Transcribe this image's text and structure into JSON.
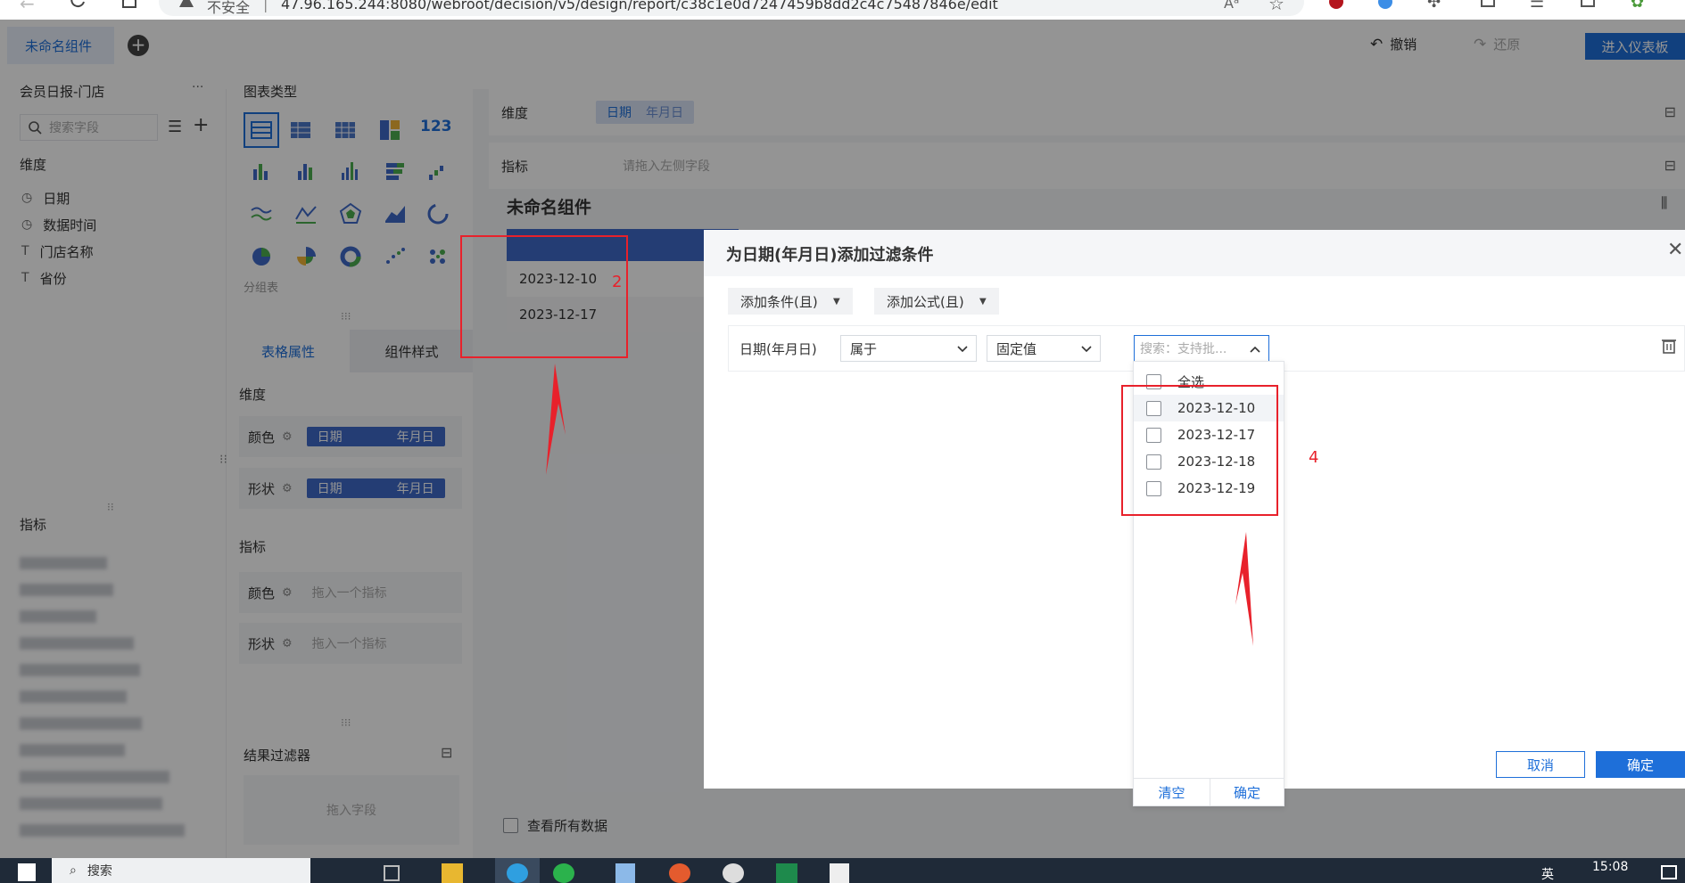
{
  "browser": {
    "security_label": "不安全",
    "url": "47.96.165.244:8080/webroot/decision/v5/design/report/c38c1e0d7247459b8dd2c4c75487846e/edit",
    "reader_label": "Aᵃ"
  },
  "app": {
    "component_name": "未命名组件",
    "undo_label": "撤销",
    "redo_label": "还原",
    "enter_dashboard_label": "进入仪表板"
  },
  "left": {
    "dataset_title": "会员日报-门店",
    "more_label": "···",
    "search_placeholder": "搜索字段",
    "dimension_header": "维度",
    "dimension_fields": [
      {
        "type_icon": "clock-icon",
        "label": "日期"
      },
      {
        "type_icon": "clock-icon",
        "label": "数据时间"
      },
      {
        "type_icon": "text-icon",
        "label": "门店名称"
      },
      {
        "type_icon": "text-icon",
        "label": "省份"
      }
    ],
    "measure_header": "指标"
  },
  "mid": {
    "chart_type_header": "图表类型",
    "chart_type_caption": "分组表",
    "tabs": [
      "表格属性",
      "组件样式"
    ],
    "dimension_header": "维度",
    "color_label": "颜色",
    "shape_label": "形状",
    "chip_field": "日期",
    "chip_sub": "年月日",
    "measure_header": "指标",
    "measure_placeholder": "拖入一个指标",
    "result_filter_label": "结果过滤器",
    "drag_field_placeholder": "拖入字段"
  },
  "work": {
    "dimension_label": "维度",
    "dimension_chip_field": "日期",
    "dimension_chip_sub": "年月日",
    "measure_label": "指标",
    "measure_placeholder": "请拖入左侧字段",
    "component_title": "未命名组件",
    "table_rows": [
      "2023-12-10",
      "2023-12-17"
    ],
    "view_all_label": "查看所有数据"
  },
  "dialog": {
    "title": "为日期(年月日)添加过滤条件",
    "add_condition_label": "添加条件(且)",
    "add_formula_label": "添加公式(且)",
    "condition_field": "日期(年月日)",
    "operator": "属于",
    "value_type": "固定值",
    "search_placeholder": "搜索：支持批...",
    "cancel_label": "取消",
    "confirm_label": "确定"
  },
  "dropdown": {
    "select_all": "全选",
    "options": [
      "2023-12-10",
      "2023-12-17",
      "2023-12-18",
      "2023-12-19"
    ],
    "clear_label": "清空",
    "confirm_label": "确定"
  },
  "annotations": {
    "box2_label": "2",
    "box4_label": "4"
  },
  "taskbar": {
    "search_label": "搜索",
    "time": "15:08",
    "ime_label": "英"
  },
  "colors": {
    "primary": "#1e6fd9",
    "chip": "#3f6ac8",
    "annotation_red": "#e8212b",
    "overlay": "rgba(0,0,0,0.42)"
  }
}
